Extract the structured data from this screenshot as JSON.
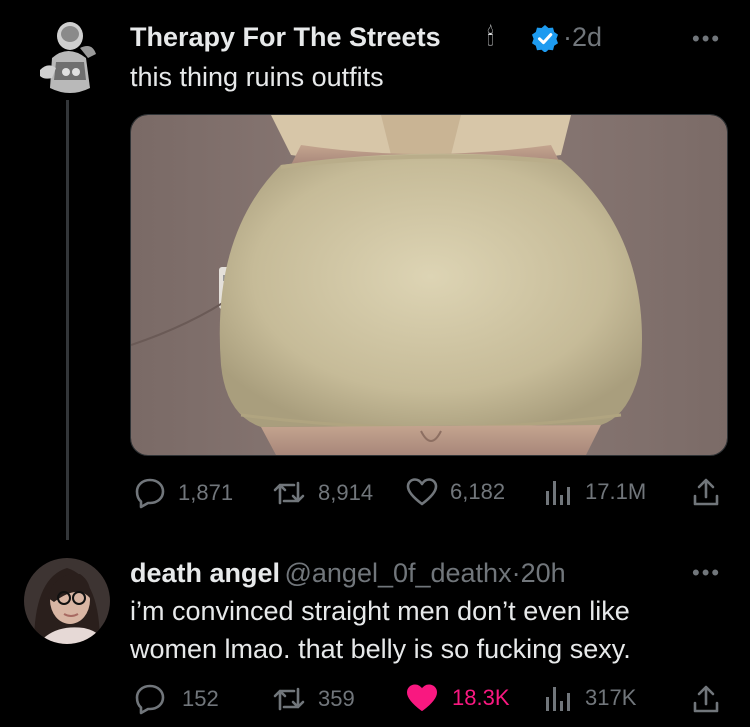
{
  "tweet": {
    "author": "Therapy For The Streets",
    "emoji": "🕯",
    "time": "2d",
    "text": "this thing ruins outfits",
    "more": "•••",
    "stats": {
      "replies": "1,871",
      "retweets": "8,914",
      "likes": "6,182",
      "views": "17.1M"
    }
  },
  "reply": {
    "author": "death angel",
    "handle": "@angel_0f_deathx",
    "time": "20h",
    "text_line1": "i’m convinced straight men don’t even like",
    "text_line2": "women lmao. that belly is so fucking sexy.",
    "more": "•••",
    "stats": {
      "replies": "152",
      "retweets": "359",
      "likes": "18.3K",
      "views": "317K"
    }
  },
  "colors": {
    "background": "#000000",
    "muted": "#71767b",
    "verified": "#1d9bf0",
    "like_active": "#f91880"
  }
}
